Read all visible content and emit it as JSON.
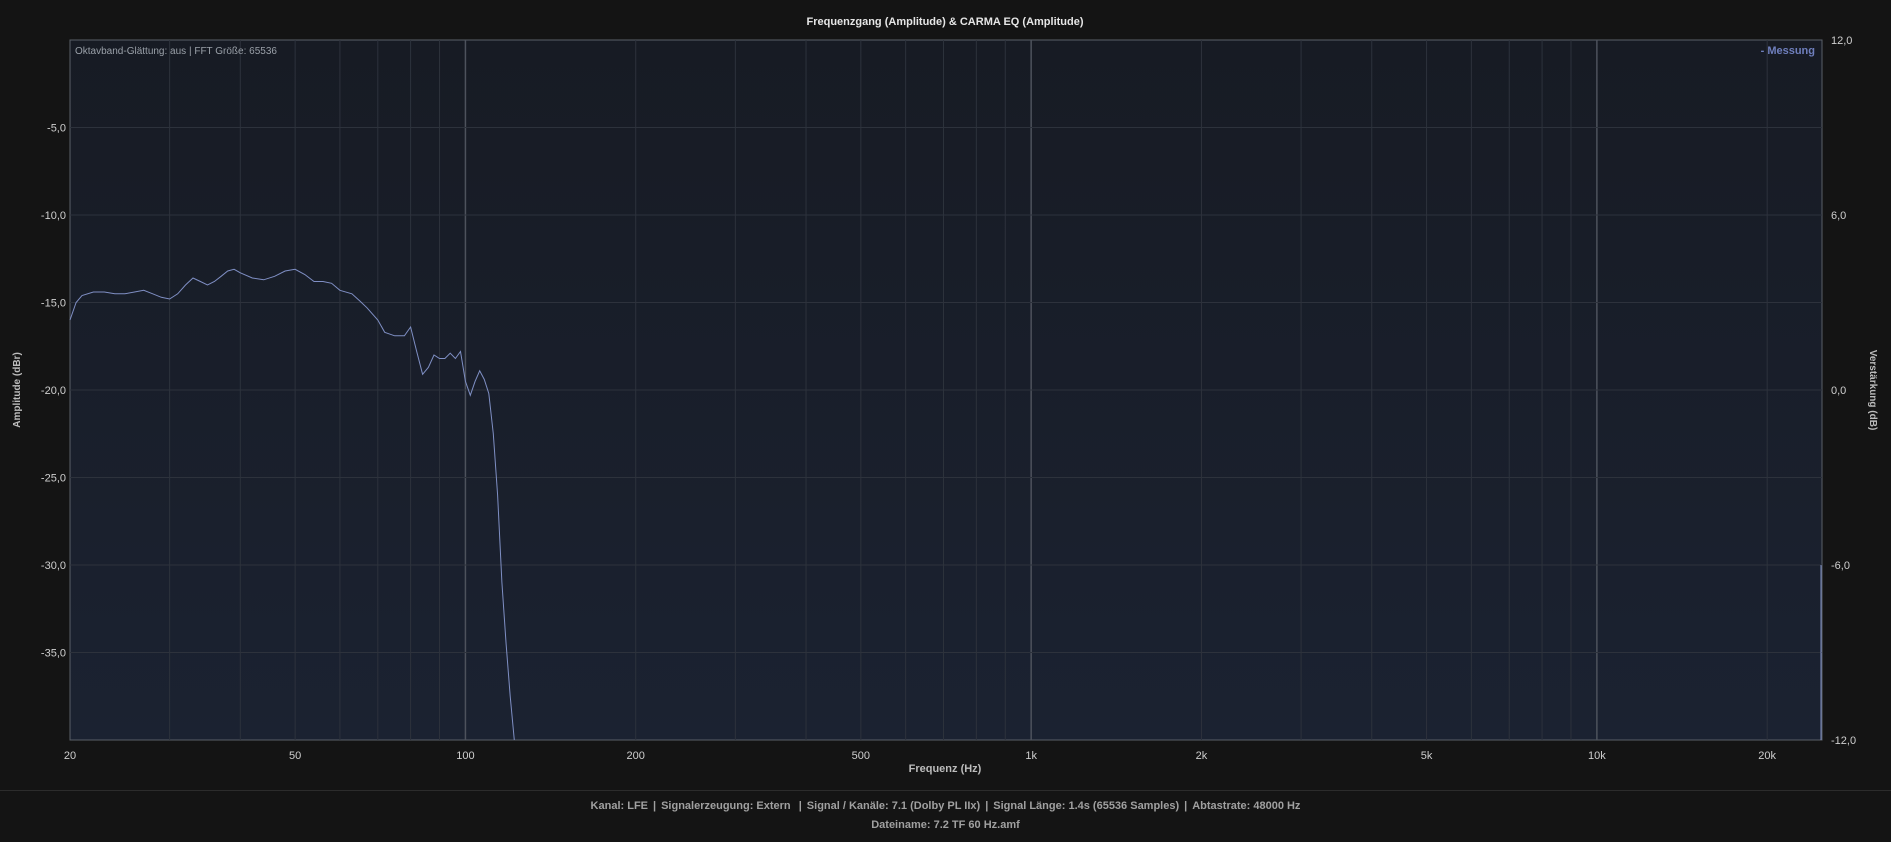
{
  "chart_data": {
    "type": "line",
    "title": "Frequenzgang (Amplitude) & CARMA EQ (Amplitude)",
    "xlabel": "Frequenz (Hz)",
    "ylabel": "Amplitude (dBr)",
    "y2label": "Verstärkung (dB)",
    "xscale": "log",
    "xlim": [
      20,
      25000
    ],
    "ylim": [
      -40,
      0
    ],
    "y2lim": [
      -12,
      12
    ],
    "x_ticks": [
      {
        "v": 20,
        "label": "20"
      },
      {
        "v": 50,
        "label": "50"
      },
      {
        "v": 100,
        "label": "100"
      },
      {
        "v": 200,
        "label": "200"
      },
      {
        "v": 500,
        "label": "500"
      },
      {
        "v": 1000,
        "label": "1k"
      },
      {
        "v": 2000,
        "label": "2k"
      },
      {
        "v": 5000,
        "label": "5k"
      },
      {
        "v": 10000,
        "label": "10k"
      },
      {
        "v": 20000,
        "label": "20k"
      }
    ],
    "y_ticks": [
      {
        "v": -5,
        "label": "-5,0"
      },
      {
        "v": -10,
        "label": "-10,0"
      },
      {
        "v": -15,
        "label": "-15,0"
      },
      {
        "v": -20,
        "label": "-20,0"
      },
      {
        "v": -25,
        "label": "-25,0"
      },
      {
        "v": -30,
        "label": "-30,0"
      },
      {
        "v": -35,
        "label": "-35,0"
      }
    ],
    "y2_ticks": [
      {
        "v": 12,
        "label": "12,0"
      },
      {
        "v": 6,
        "label": "6,0"
      },
      {
        "v": 0,
        "label": "0,0"
      },
      {
        "v": -6,
        "label": "-6,0"
      },
      {
        "v": -12,
        "label": "-12,0"
      }
    ],
    "annotation": "Oktavband-Glättung: aus | FFT Größe: 65536",
    "legend_position": "top-right",
    "grid": true,
    "series": [
      {
        "name": "Messung",
        "color": "#7f8fc4",
        "x": [
          20,
          20.5,
          21,
          22,
          23,
          24,
          25,
          26,
          27,
          28,
          29,
          30,
          31,
          32,
          33,
          34,
          35,
          36,
          37,
          38,
          39,
          40,
          42,
          44,
          46,
          48,
          50,
          52,
          54,
          56,
          58,
          60,
          63,
          65,
          67,
          70,
          72,
          75,
          78,
          80,
          82,
          84,
          86,
          88,
          90,
          92,
          94,
          96,
          98,
          100,
          102,
          104,
          106,
          108,
          110,
          112,
          114,
          116,
          118,
          120,
          122
        ],
        "values": [
          -16.0,
          -15.0,
          -14.6,
          -14.4,
          -14.4,
          -14.5,
          -14.5,
          -14.4,
          -14.3,
          -14.5,
          -14.7,
          -14.8,
          -14.5,
          -14.0,
          -13.6,
          -13.8,
          -14.0,
          -13.8,
          -13.5,
          -13.2,
          -13.1,
          -13.3,
          -13.6,
          -13.7,
          -13.5,
          -13.2,
          -13.1,
          -13.4,
          -13.8,
          -13.8,
          -13.9,
          -14.3,
          -14.5,
          -14.9,
          -15.3,
          -16.0,
          -16.7,
          -16.9,
          -16.9,
          -16.4,
          -17.8,
          -19.1,
          -18.7,
          -18.0,
          -18.2,
          -18.2,
          -17.9,
          -18.2,
          -17.8,
          -19.5,
          -20.3,
          -19.5,
          -18.9,
          -19.4,
          -20.2,
          -22.5,
          -26.0,
          -31.0,
          -34.5,
          -37.5,
          -40.0
        ]
      },
      {
        "name": "CARMA EQ",
        "color": "#7f8fc4",
        "x": [
          24900,
          24900
        ],
        "values": [
          -30.0,
          -40.0
        ]
      }
    ]
  },
  "footer": {
    "kanal": "Kanal: LFE",
    "signalerzeugung": "Signalerzeugung: Extern",
    "signal_kanaele": "Signal / Kanäle: 7.1 (Dolby PL IIx)",
    "signal_laenge": "Signal Länge: 1.4s (65536 Samples)",
    "abtastrate": "Abtastrate: 48000 Hz",
    "dateiname": "Dateiname: 7.2 TF 60 Hz.amf"
  }
}
